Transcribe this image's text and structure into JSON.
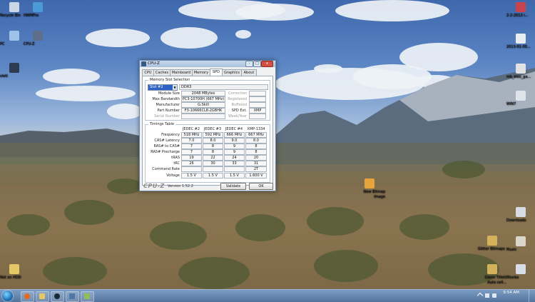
{
  "desktop": {
    "icons_left": [
      {
        "label": "Recycle Bin",
        "icon": "recycle-bin-icon",
        "color": "#c9d6e6"
      },
      {
        "label": "HWMPro",
        "icon": "hwmonitor-icon",
        "color": "#4a9ad8"
      },
      {
        "label": "PC",
        "icon": "computer-icon",
        "color": "#9fc3e8"
      },
      {
        "label": "CPU-Z",
        "icon": "cpuz-icon",
        "color": "#5d6f8a"
      },
      {
        "label": "slett",
        "icon": "folder-icon",
        "color": "#2d3b52"
      },
      {
        "label": "Not on HDD",
        "icon": "folder-icon",
        "color": "#e6c766"
      }
    ],
    "icons_right": [
      {
        "label": "2-2-2013 i...",
        "icon": "image-file-icon",
        "color": "#c8434c"
      },
      {
        "label": "2013-01-05...",
        "icon": "document-icon",
        "color": "#e9edf1"
      },
      {
        "label": "mb_bios_ga...",
        "icon": "zip-file-icon",
        "color": "#e2e2e2"
      },
      {
        "label": "WIN7",
        "icon": "disc-icon",
        "color": "#dfe4ea"
      },
      {
        "label": "Downloads",
        "icon": "downloads-folder-icon",
        "color": "#d7dce4"
      },
      {
        "label": "Music",
        "icon": "music-folder-icon",
        "color": "#dad6cc"
      },
      {
        "label": "Movies",
        "icon": "movies-folder-icon",
        "color": "#d7dde6"
      }
    ],
    "icons_middle": [
      {
        "label": "New Bitmap Image",
        "icon": "bitmap-icon",
        "color": "#e8a43c"
      },
      {
        "label": "Glitter Bitmaps",
        "icon": "folder-icon",
        "color": "#d4b25b"
      },
      {
        "label": "Glenn Tillett Auto cell...",
        "icon": "folder-icon",
        "color": "#d4b25b"
      }
    ]
  },
  "taskbar": {
    "start_icon": "windows-start-icon",
    "pinned": [
      {
        "name": "firefox-icon",
        "color": "#e46a1f"
      },
      {
        "name": "explorer-icon",
        "color": "#e6c766"
      },
      {
        "name": "steam-icon",
        "color": "#1b2838"
      },
      {
        "name": "cpuz-taskbar-icon",
        "color": "#4e77a8"
      },
      {
        "name": "app-icon",
        "color": "#8fbf5a"
      }
    ],
    "clock_time": "9:54 AM",
    "clock_date": ""
  },
  "cpuz": {
    "title": "CPU-Z",
    "window_buttons": {
      "minimize": "-",
      "maximize": "□",
      "close": "x"
    },
    "tabs": [
      "CPU",
      "Caches",
      "Mainboard",
      "Memory",
      "SPD",
      "Graphics",
      "About"
    ],
    "active_tab": "SPD",
    "slot_section": {
      "title": "Memory Slot Selection",
      "slot": "Slot #2",
      "type": "DDR3",
      "module_size_label": "Module Size",
      "module_size": "2048 MBytes",
      "max_bandwidth_label": "Max Bandwidth",
      "max_bandwidth": "PC3-10700H (667 MHz)",
      "manufacturer_label": "Manufacturer",
      "manufacturer": "G.Skill",
      "part_number_label": "Part Number",
      "part_number": "F3-10666CL8-2GBHK",
      "serial_label": "Serial Number",
      "serial": "",
      "correction_label": "Correction",
      "registered_label": "Registered",
      "buffered_label": "Buffered",
      "spd_ext_label": "SPD Ext.",
      "spd_ext": "XMP",
      "week_year_label": "Week/Year"
    },
    "timings": {
      "title": "Timings Table",
      "columns": [
        "JEDEC #2",
        "JEDEC #3",
        "JEDEC #4",
        "XMP-1334"
      ],
      "rows": [
        {
          "label": "Frequency",
          "values": [
            "518 MHz",
            "592 MHz",
            "666 MHz",
            "667 MHz"
          ]
        },
        {
          "label": "CAS# Latency",
          "values": [
            "7.0",
            "8.0",
            "9.0",
            "8.0"
          ]
        },
        {
          "label": "RAS# to CAS#",
          "values": [
            "7",
            "8",
            "9",
            "8"
          ]
        },
        {
          "label": "RAS# Precharge",
          "values": [
            "7",
            "8",
            "9",
            "8"
          ]
        },
        {
          "label": "tRAS",
          "values": [
            "19",
            "22",
            "24",
            "20"
          ]
        },
        {
          "label": "tRC",
          "values": [
            "26",
            "30",
            "33",
            "31"
          ]
        },
        {
          "label": "Command Rate",
          "values": [
            "",
            "",
            "",
            "2T"
          ]
        },
        {
          "label": "Voltage",
          "values": [
            "1.5 V",
            "1.5 V",
            "1.5 V",
            "1.600 V"
          ]
        }
      ]
    },
    "footer": {
      "brand": "CPU-Z",
      "version": "Version 1.52.2",
      "validate": "Validate",
      "ok": "OK"
    }
  }
}
